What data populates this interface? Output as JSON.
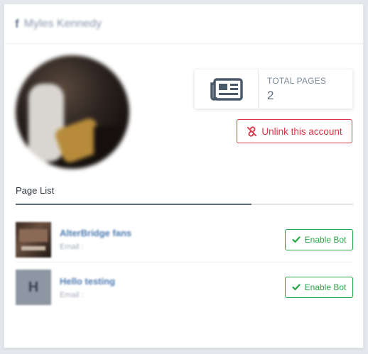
{
  "header": {
    "fb_icon": "f",
    "profile_name": "Myles Kennedy"
  },
  "stats": {
    "label": "TOTAL PAGES",
    "value": "2",
    "icon": "newspaper-icon"
  },
  "actions": {
    "unlink_label": "Unlink this account"
  },
  "tabs": {
    "page_list": "Page List"
  },
  "pages": [
    {
      "name": "AlterBridge fans",
      "email": "Email :",
      "button": "Enable Bot",
      "thumb": "image"
    },
    {
      "name": "Hello testing",
      "email": "Email :",
      "button": "Enable Bot",
      "thumb_letter": "H"
    }
  ],
  "colors": {
    "danger": "#dc3545",
    "success": "#28a745",
    "link": "#4d7ab0"
  }
}
